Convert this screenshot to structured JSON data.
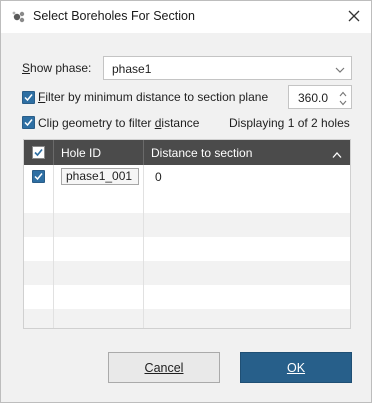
{
  "window": {
    "title": "Select Boreholes For Section",
    "app_icon": "seequent-logo-icon",
    "close_icon": "close-icon"
  },
  "phase": {
    "label_prefix": "",
    "label_mnemonic": "S",
    "label_rest": "how phase:",
    "selected": "phase1",
    "chevron_icon": "chevron-down-icon"
  },
  "filter": {
    "checked": true,
    "label_mnemonic": "F",
    "label_rest": "ilter by minimum distance to section plane",
    "value": "360.0",
    "spin_up_icon": "chevron-up-icon",
    "spin_down_icon": "chevron-down-icon"
  },
  "clip": {
    "checked": true,
    "label_before": "Clip geometry to filter ",
    "label_mnemonic": "d",
    "label_after": "istance"
  },
  "status": {
    "displaying": "Displaying 1 of 2 holes"
  },
  "table": {
    "columns": [
      "Hole ID",
      "Distance to section"
    ],
    "header_checked": true,
    "sort_icon": "chevron-up-icon",
    "rows": [
      {
        "checked": true,
        "hole_id": "phase1_001",
        "distance": "0"
      }
    ]
  },
  "buttons": {
    "cancel_mnemonic": "C",
    "cancel_rest": "ancel",
    "ok_mnemonic": "O",
    "ok_rest": "K"
  },
  "colors": {
    "accent": "#275f8a",
    "header_bg": "#4b4b4b",
    "checkbox": "#2e6fa3"
  }
}
